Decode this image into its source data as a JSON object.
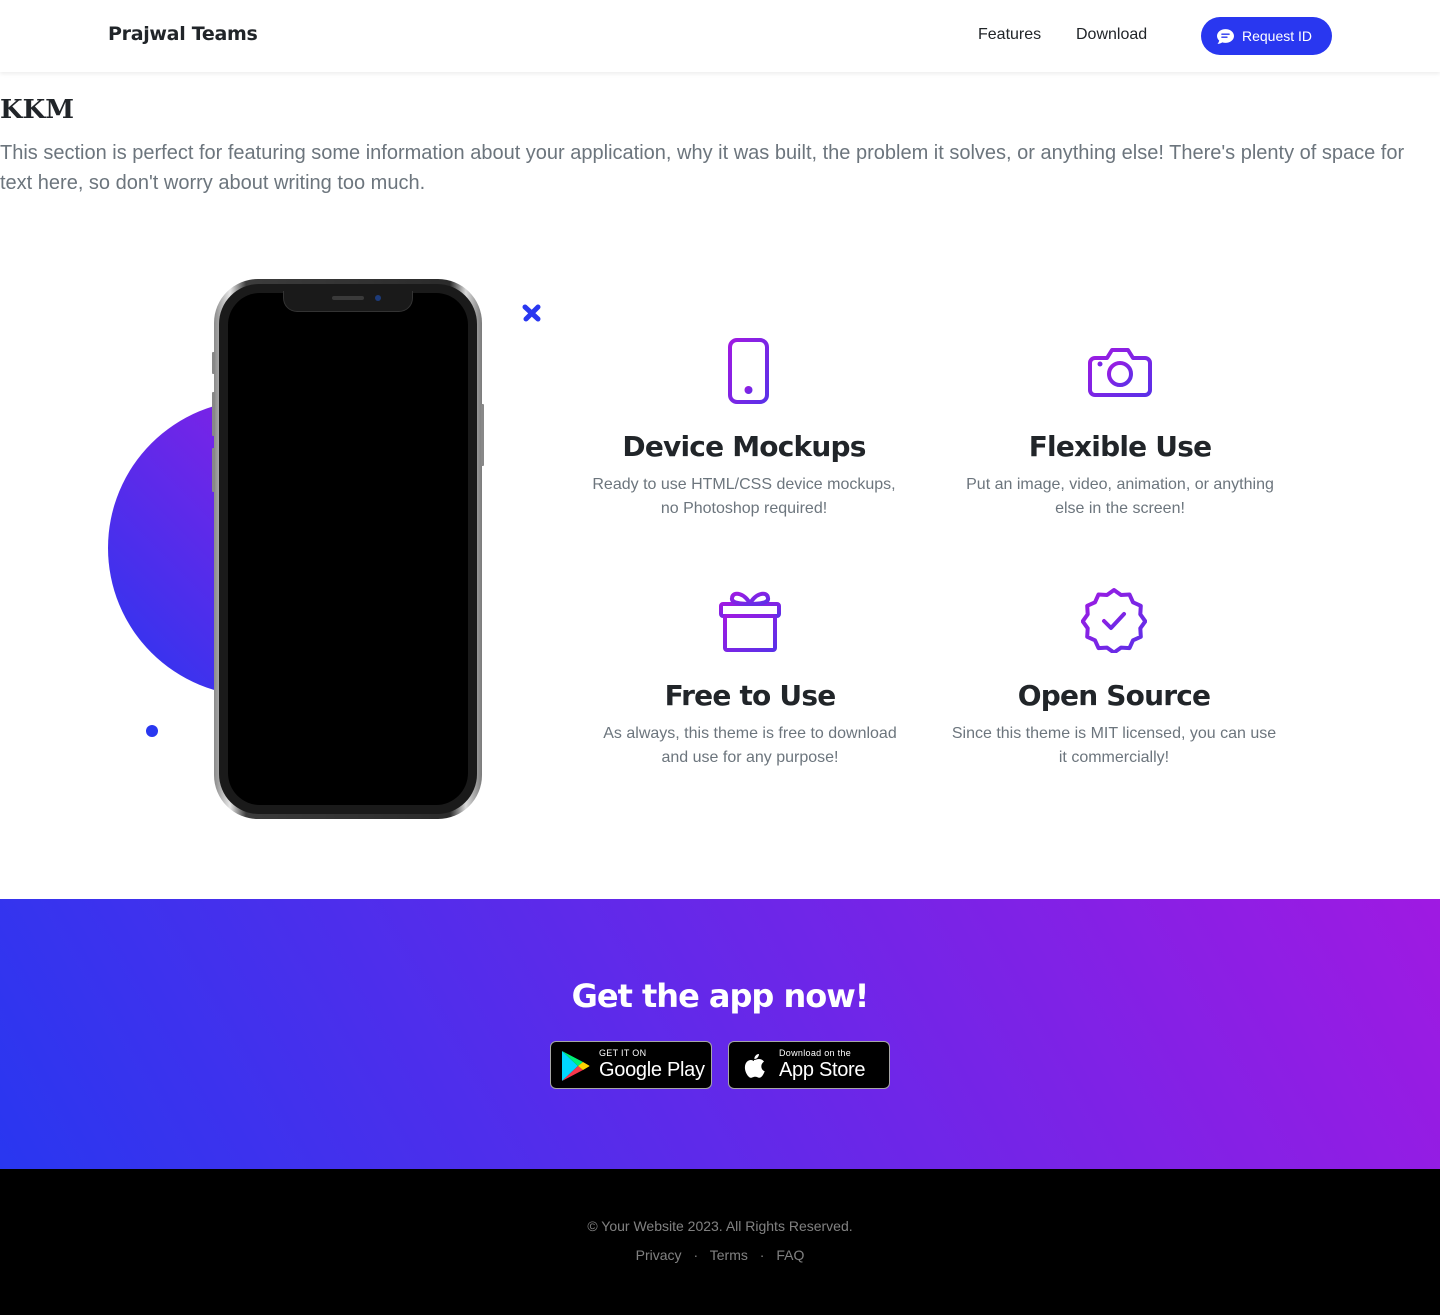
{
  "navbar": {
    "brand": "Prajwal Teams",
    "links": [
      "Features",
      "Download"
    ],
    "cta_label": "Request ID",
    "cta_icon": "chat-bubble-icon"
  },
  "about": {
    "title": "KKM",
    "text": "This section is perfect for featuring some information about your application, why it was built, the problem it solves, or anything else! There's plenty of space for text here, so don't worry about writing too much."
  },
  "features": [
    {
      "icon": "phone-icon",
      "title": "Device Mockups",
      "text": "Ready to use HTML/CSS device mockups, no Photoshop required!"
    },
    {
      "icon": "camera-icon",
      "title": "Flexible Use",
      "text": "Put an image, video, animation, or anything else in the screen!"
    },
    {
      "icon": "gift-icon",
      "title": "Free to Use",
      "text": "As always, this theme is free to download and use for any purpose!"
    },
    {
      "icon": "patch-check-icon",
      "title": "Open Source",
      "text": "Since this theme is MIT licensed, you can use it commercially!"
    }
  ],
  "cta": {
    "title": "Get the app now!",
    "google_play": {
      "small": "GET IT ON",
      "big": "Google Play"
    },
    "app_store": {
      "small": "Download on the",
      "big": "App Store"
    }
  },
  "footer": {
    "copyright": "© Your Website 2023. All Rights Reserved.",
    "links": [
      "Privacy",
      "Terms",
      "FAQ"
    ],
    "separator": "·"
  },
  "colors": {
    "primary": "#2937f0",
    "secondary": "#9f1ae2",
    "icon": "#7b2be2",
    "text_muted": "#6c757d"
  }
}
